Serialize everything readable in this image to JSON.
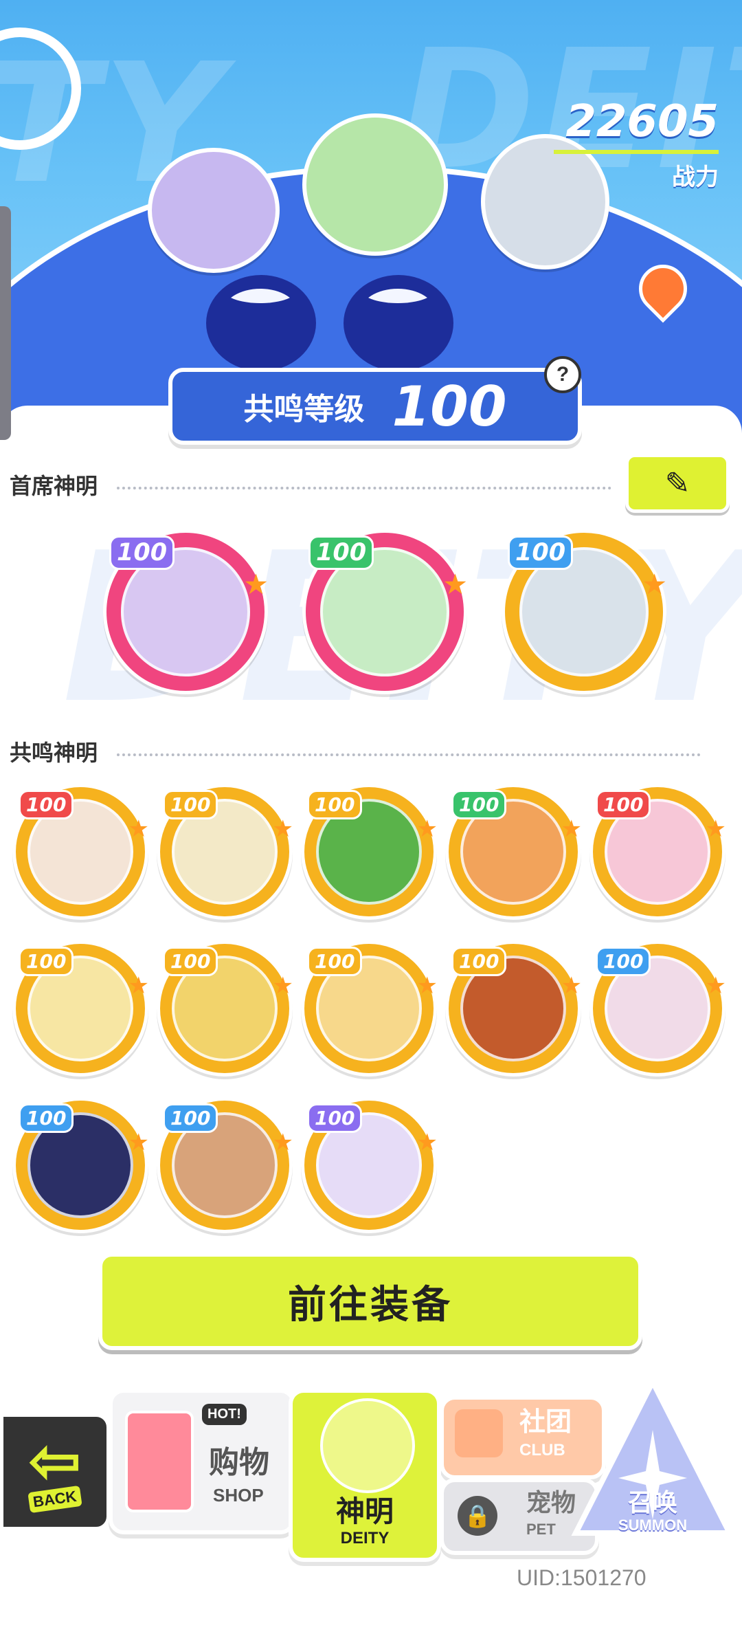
{
  "header": {
    "bg_text": "DEITY",
    "power_value": "22605",
    "power_label": "战力",
    "resonance_label": "共鸣等级",
    "resonance_level": "100",
    "help_label": "?"
  },
  "sections": {
    "leaders_title": "首席神明",
    "resonance_title": "共鸣神明",
    "edit_label": "✎"
  },
  "leaders": [
    {
      "level": "100",
      "name": "leader-1",
      "ring": "#f0457f",
      "lvl_color": "#8a6df0",
      "face": "#d8c7f2"
    },
    {
      "level": "100",
      "name": "leader-2",
      "ring": "#f0457f",
      "lvl_color": "#39c36b",
      "face": "#c7ecc4"
    },
    {
      "level": "100",
      "name": "leader-3",
      "ring": "#f6b21e",
      "lvl_color": "#3f9ff0",
      "face": "#d9e2ea"
    }
  ],
  "deities": [
    {
      "level": "100",
      "lvl_color": "#f04a4a",
      "face": "#f4e4d6"
    },
    {
      "level": "100",
      "lvl_color": "#f6b21e",
      "face": "#f3e9c7"
    },
    {
      "level": "100",
      "lvl_color": "#f6b21e",
      "face": "#5ab34a"
    },
    {
      "level": "100",
      "lvl_color": "#39c36b",
      "face": "#f2a35b"
    },
    {
      "level": "100",
      "lvl_color": "#f04a4a",
      "face": "#f7c7d7"
    },
    {
      "level": "100",
      "lvl_color": "#f6b21e",
      "face": "#f7e6a3"
    },
    {
      "level": "100",
      "lvl_color": "#f6b21e",
      "face": "#f2d36b"
    },
    {
      "level": "100",
      "lvl_color": "#f6b21e",
      "face": "#f7d88b"
    },
    {
      "level": "100",
      "lvl_color": "#f6b21e",
      "face": "#c35b2c"
    },
    {
      "level": "100",
      "lvl_color": "#3f9ff0",
      "face": "#f1dbe8"
    },
    {
      "level": "100",
      "lvl_color": "#3f9ff0",
      "face": "#2b2f66"
    },
    {
      "level": "100",
      "lvl_color": "#3f9ff0",
      "face": "#d8a37a"
    },
    {
      "level": "100",
      "lvl_color": "#8a6df0",
      "face": "#e6dcf7"
    }
  ],
  "equip_button": "前往装备",
  "nav": {
    "back": "BACK",
    "shop_zh": "购物",
    "shop_en": "SHOP",
    "shop_hot": "HOT!",
    "deity_zh": "神明",
    "deity_en": "DEITY",
    "club_zh": "社团",
    "club_en": "CLUB",
    "pet_zh": "宠物",
    "pet_en": "PET",
    "summon_zh": "召唤",
    "summon_en": "SUMMON"
  },
  "uid": "UID:1501270"
}
